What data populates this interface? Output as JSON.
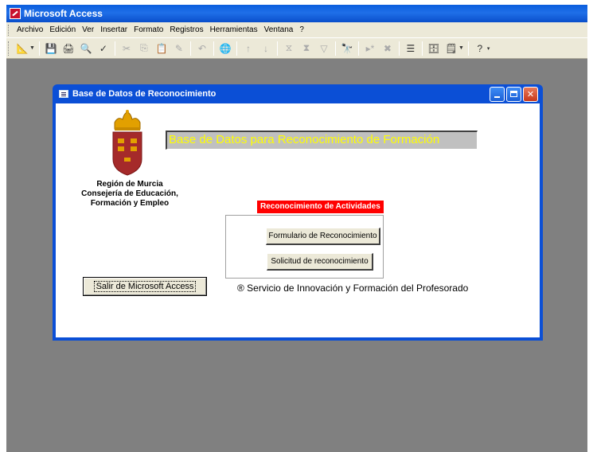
{
  "app": {
    "title": "Microsoft Access"
  },
  "menubar": {
    "items": [
      "Archivo",
      "Edición",
      "Ver",
      "Insertar",
      "Formato",
      "Registros",
      "Herramientas",
      "Ventana",
      "?"
    ]
  },
  "toolbar": {
    "icons": [
      "view-icon",
      "save-icon",
      "print-icon",
      "print-preview-icon",
      "spelling-icon",
      "cut-icon",
      "copy-icon",
      "paste-icon",
      "format-painter-icon",
      "undo-icon",
      "insert-hyperlink-icon",
      "sort-ascending-icon",
      "sort-descending-icon",
      "filter-by-selection-icon",
      "filter-by-form-icon",
      "apply-filter-icon",
      "find-icon",
      "new-record-icon",
      "delete-record-icon",
      "properties-icon",
      "database-window-icon",
      "new-object-icon",
      "help-icon"
    ]
  },
  "form": {
    "title": "Base de Datos de Reconocimiento",
    "main_title": "Base de Datos para Reconocimiento de Formación",
    "org_line1": "Región de Murcia",
    "org_line2": "Consejería de Educación,",
    "org_line3": "Formación y Empleo",
    "activities_label": "Reconocimiento de Actividades",
    "btn_formulario": "Formulario de Reconocimiento",
    "btn_solicitud": "Solicitud de reconocimiento",
    "btn_salir": "Salir de Microsoft Access",
    "credit": "® Servicio de Innovación y Formación del Profesorado"
  },
  "colors": {
    "title_bar": "#0a5ddd",
    "mdi_background": "#808080",
    "label_red": "#ff0000",
    "title_yellow": "#ffff00",
    "crest_red": "#a52a2a",
    "crown_gold": "#e2a000"
  }
}
